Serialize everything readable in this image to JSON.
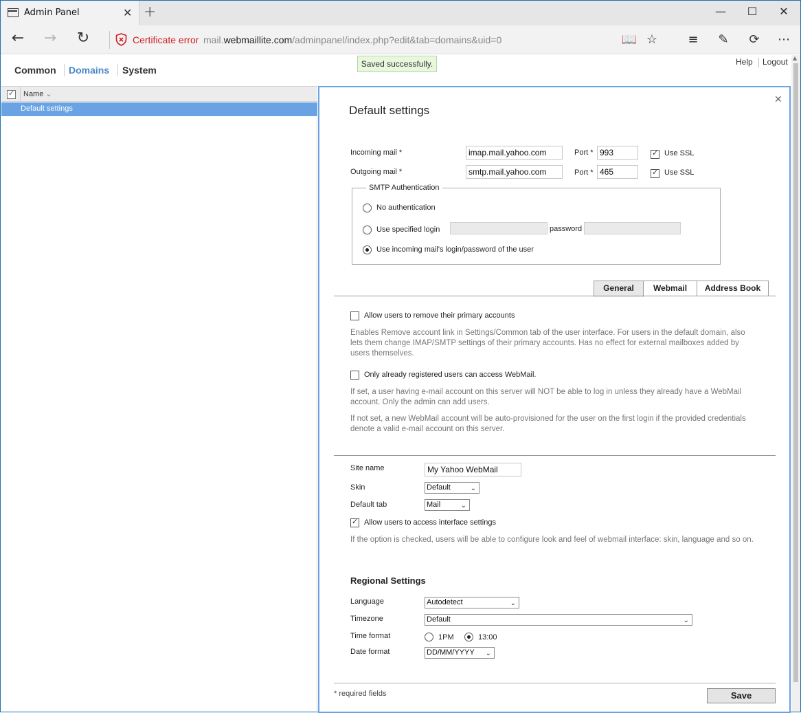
{
  "browser": {
    "tab_title": "Admin Panel",
    "cert_error": "Certificate error",
    "url_prefix": "mail.",
    "url_host": "webmaillite.com",
    "url_path": "/adminpanel/index.php?edit&tab=domains&uid=0"
  },
  "header": {
    "tabs": [
      "Common",
      "Domains",
      "System"
    ],
    "active_tab": "Domains",
    "saved_message": "Saved successfully.",
    "help": "Help",
    "logout": "Logout"
  },
  "list": {
    "column_name": "Name",
    "rows": [
      "Default settings"
    ]
  },
  "panel": {
    "title": "Default settings",
    "incoming_label": "Incoming mail *",
    "incoming_value": "imap.mail.yahoo.com",
    "incoming_port_label": "Port *",
    "incoming_port": "993",
    "outgoing_label": "Outgoing mail *",
    "outgoing_value": "smtp.mail.yahoo.com",
    "outgoing_port_label": "Port *",
    "outgoing_port": "465",
    "use_ssl": "Use SSL",
    "smtp_auth": {
      "legend": "SMTP Authentication",
      "options": [
        "No authentication",
        "Use specified login",
        "Use incoming mail's login/password of the user"
      ],
      "selected": 2,
      "password_placeholder": "password"
    },
    "tabs": [
      "General",
      "Webmail",
      "Address Book"
    ],
    "active_tab": "General",
    "general": {
      "allow_remove_label": "Allow users to remove their primary accounts",
      "allow_remove_checked": false,
      "allow_remove_help": "Enables Remove account link in Settings/Common tab of the user interface. For users in the default domain, also lets them change IMAP/SMTP settings of their primary accounts. Has no effect for external mailboxes added by users themselves.",
      "registered_only_label": "Only already registered users can access WebMail.",
      "registered_only_checked": false,
      "registered_only_help1": "If set, a user having e-mail account on this server will NOT be able to log in unless they already have a WebMail account. Only the admin can add users.",
      "registered_only_help2": "If not set, a new WebMail account will be auto-provisioned for the user on the first login if the provided credentials denote a valid e-mail account on this server."
    },
    "site_name_label": "Site name",
    "site_name_value": "My Yahoo WebMail",
    "skin_label": "Skin",
    "skin_value": "Default",
    "default_tab_label": "Default tab",
    "default_tab_value": "Mail",
    "allow_interface_label": "Allow users to access interface settings",
    "allow_interface_checked": true,
    "allow_interface_help": "If the option is checked, users will be able to configure look and feel of webmail interface: skin, language and so on.",
    "regional_title": "Regional Settings",
    "language_label": "Language",
    "language_value": "Autodetect",
    "timezone_label": "Timezone",
    "timezone_value": "Default",
    "time_format_label": "Time format",
    "time_format_options": [
      "1PM",
      "13:00"
    ],
    "time_format_selected": "13:00",
    "date_format_label": "Date format",
    "date_format_value": "DD/MM/YYYY",
    "required_note": "* required fields",
    "save_label": "Save"
  }
}
